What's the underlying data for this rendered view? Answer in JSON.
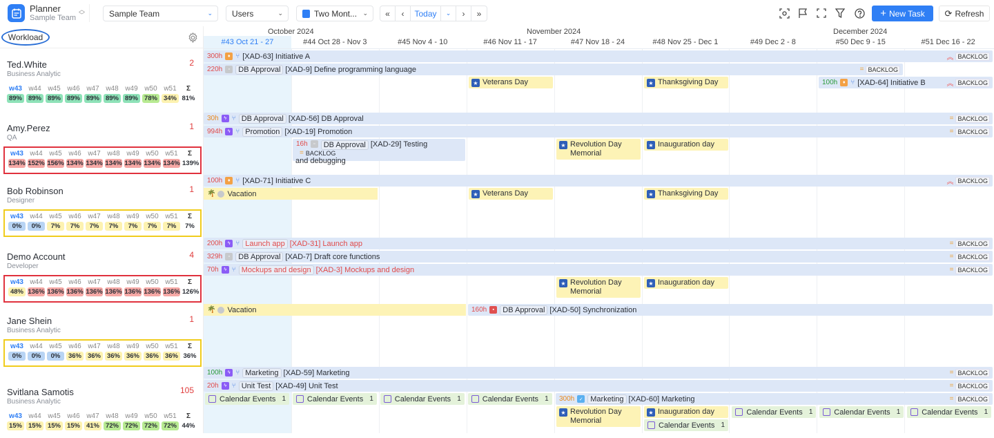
{
  "app": {
    "title": "Planner",
    "subtitle": "Sample Team"
  },
  "toolbar": {
    "team_select": "Sample Team",
    "group_select": "Users",
    "view_select": "Two Mont...",
    "today_label": "Today",
    "new_task_label": "New Task",
    "refresh_label": "Refresh",
    "icons": [
      "scan-icon",
      "flag-icon",
      "fullscreen-icon",
      "filter-icon",
      "help-icon"
    ]
  },
  "sidebar": {
    "title": "Workload",
    "week_labels": [
      "w43",
      "w44",
      "w45",
      "w46",
      "w47",
      "w48",
      "w49",
      "w50",
      "w51"
    ],
    "sum_label": "Σ",
    "users": [
      {
        "name": "Ted.White",
        "role": "Business Analytic",
        "count": "2",
        "values": [
          "89%",
          "89%",
          "89%",
          "89%",
          "89%",
          "89%",
          "89%",
          "78%",
          "34%"
        ],
        "colors": [
          "g",
          "g",
          "g",
          "g",
          "g",
          "g",
          "g",
          "lg",
          "y"
        ],
        "sum": "81%",
        "highlight": ""
      },
      {
        "name": "Amy.Perez",
        "role": "QA",
        "count": "1",
        "values": [
          "134%",
          "152%",
          "156%",
          "134%",
          "134%",
          "134%",
          "134%",
          "134%",
          "134%"
        ],
        "colors": [
          "r",
          "r",
          "r",
          "r",
          "r",
          "r",
          "r",
          "r",
          "r"
        ],
        "sum": "139%",
        "highlight": "red"
      },
      {
        "name": "Bob Robinson",
        "role": "Designer",
        "count": "1",
        "values": [
          "0%",
          "0%",
          "7%",
          "7%",
          "7%",
          "7%",
          "7%",
          "7%",
          "7%"
        ],
        "colors": [
          "b",
          "b",
          "y",
          "y",
          "y",
          "y",
          "y",
          "y",
          "y"
        ],
        "sum": "7%",
        "highlight": "yellow"
      },
      {
        "name": "Demo Account",
        "role": "Developer",
        "count": "4",
        "values": [
          "48%",
          "136%",
          "136%",
          "136%",
          "136%",
          "136%",
          "136%",
          "136%",
          "136%"
        ],
        "colors": [
          "y",
          "r",
          "r",
          "r",
          "r",
          "r",
          "r",
          "r",
          "r"
        ],
        "sum": "126%",
        "highlight": "red"
      },
      {
        "name": "Jane Shein",
        "role": "Business Analytic",
        "count": "1",
        "values": [
          "0%",
          "0%",
          "0%",
          "36%",
          "36%",
          "36%",
          "36%",
          "36%",
          "36%"
        ],
        "colors": [
          "b",
          "b",
          "b",
          "y",
          "y",
          "y",
          "y",
          "y",
          "y"
        ],
        "sum": "36%",
        "highlight": "yellow"
      },
      {
        "name": "Svitlana Samotis",
        "role": "Business Analytic",
        "count": "105",
        "values": [
          "15%",
          "15%",
          "15%",
          "15%",
          "41%",
          "72%",
          "72%",
          "72%",
          "72%"
        ],
        "colors": [
          "y",
          "y",
          "y",
          "y",
          "y",
          "lg",
          "lg",
          "lg",
          "lg"
        ],
        "sum": "44%",
        "highlight": ""
      }
    ]
  },
  "calendar": {
    "months": [
      "October 2024",
      "November 2024",
      "December 2024"
    ],
    "weeks": [
      "#43 Oct 21 - 27",
      "#44 Oct 28 - Nov 3",
      "#45 Nov 4 - 10",
      "#46 Nov 11 - 17",
      "#47 Nov 18 - 24",
      "#48 Nov 25 - Dec 1",
      "#49 Dec 2 - 8",
      "#50 Dec 9 - 15",
      "#51 Dec 16 - 22"
    ],
    "backlog_label": "BACKLOG",
    "tasks": {
      "t1": {
        "hours": "300h",
        "title": "[XAD-63] Initiative A"
      },
      "t2": {
        "hours": "220h",
        "tag": "DB Approval",
        "title": "[XAD-9] Define programming language"
      },
      "t3": {
        "hours": "100h",
        "title": "[XAD-64] Initiative B"
      },
      "t4": {
        "hours": "30h",
        "tag": "DB Approval",
        "title": "[XAD-56] DB Approval"
      },
      "t5": {
        "hours": "994h",
        "tag": "Promotion",
        "title": "[XAD-19] Promotion"
      },
      "t6": {
        "hours": "16h",
        "tag": "DB Approval",
        "title": "[XAD-29] Testing",
        "title2": "and debugging"
      },
      "t7": {
        "hours": "100h",
        "title": "[XAD-71] Initiative C"
      },
      "t8": {
        "hours": "200h",
        "tag": "Launch app",
        "title": "[XAD-31] Launch app"
      },
      "t9": {
        "hours": "329h",
        "tag": "DB Approval",
        "title": "[XAD-7] Draft core functions"
      },
      "t10": {
        "hours": "70h",
        "tag": "Mockups and design",
        "title": "[XAD-3] Mockups and design"
      },
      "t11": {
        "hours": "160h",
        "tag": "DB Approval",
        "title": "[XAD-50] Synchronization"
      },
      "t12": {
        "hours": "100h",
        "tag": "Marketing",
        "title": "[XAD-59] Marketing"
      },
      "t13": {
        "hours": "20h",
        "tag": "Unit Test",
        "title": "[XAD-49] Unit Test"
      },
      "t14": {
        "hours": "300h",
        "tag": "Marketing",
        "title": "[XAD-60] Marketing"
      }
    },
    "holidays": {
      "veterans": "Veterans Day",
      "thanksgiving": "Thanksgiving Day",
      "revolution": "Revolution Day Memorial",
      "inauguration": "Inauguration day",
      "vacation": "Vacation"
    },
    "calendar_events": {
      "label": "Calendar Events",
      "count": "1"
    }
  }
}
